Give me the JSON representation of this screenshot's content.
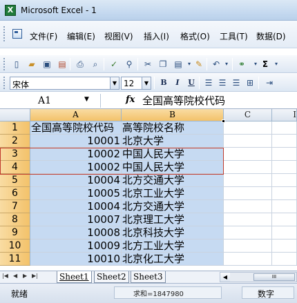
{
  "window": {
    "title": "Microsoft Excel - 1",
    "app_icon_letter": "X"
  },
  "menu": [
    "文件(F)",
    "编辑(E)",
    "视图(V)",
    "插入(I)",
    "格式(O)",
    "工具(T)",
    "数据(D)"
  ],
  "formatting": {
    "font_name": "宋体",
    "font_size": "12",
    "bold_label": "B",
    "italic_label": "I",
    "underline_label": "U",
    "autosum_label": "Σ"
  },
  "formula_bar": {
    "name_box": "A1",
    "fx_label": "fx",
    "value": "全国高等院校代码"
  },
  "grid": {
    "columns": [
      "A",
      "B",
      "C",
      "I"
    ],
    "rows": [
      {
        "num": "1",
        "a": "全国高等院校代码",
        "b": "高等院校名称"
      },
      {
        "num": "2",
        "a": "10001",
        "b": "北京大学"
      },
      {
        "num": "3",
        "a": "10002",
        "b": "中国人民大学"
      },
      {
        "num": "4",
        "a": "10002",
        "b": "中国人民大学"
      },
      {
        "num": "5",
        "a": "10004",
        "b": "北方交通大学"
      },
      {
        "num": "6",
        "a": "10005",
        "b": "北京工业大学"
      },
      {
        "num": "7",
        "a": "10004",
        "b": "北方交通大学"
      },
      {
        "num": "8",
        "a": "10007",
        "b": "北京理工大学"
      },
      {
        "num": "9",
        "a": "10008",
        "b": "北京科技大学"
      },
      {
        "num": "10",
        "a": "10009",
        "b": "北方工业大学"
      },
      {
        "num": "11",
        "a": "10010",
        "b": "北京化工大学"
      }
    ]
  },
  "sheets": [
    "Sheet1",
    "Sheet2",
    "Sheet3"
  ],
  "scroll": {
    "thumb_label": "III"
  },
  "status": {
    "ready": "就绪",
    "sum": "求和=1847980",
    "mode": "数字"
  }
}
